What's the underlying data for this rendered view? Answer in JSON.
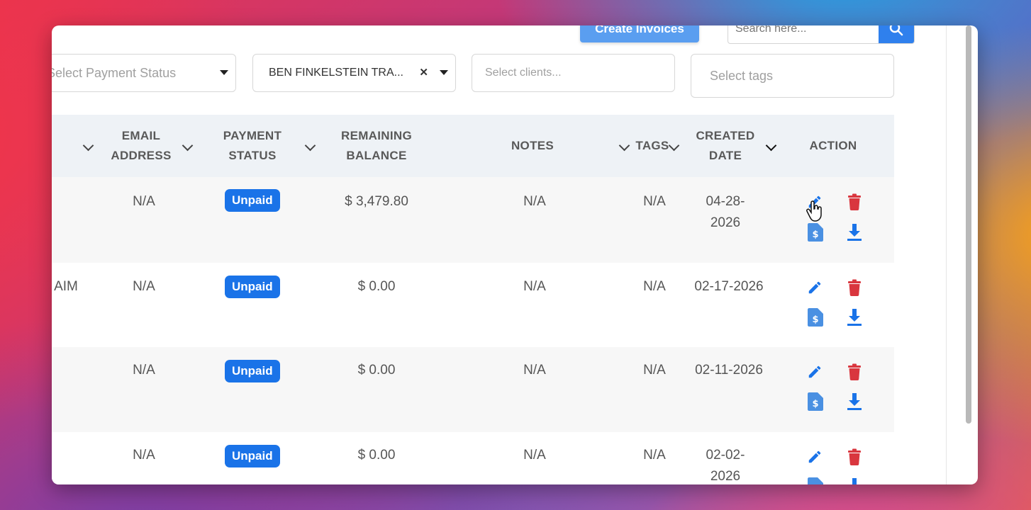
{
  "toolbar": {
    "create_label": "Create Invoices",
    "search_placeholder": "Search here..."
  },
  "filters": {
    "payment_status_placeholder": "Select Payment Status",
    "client_selected": "BEN FINKELSTEIN TRA...",
    "clients_placeholder": "Select clients...",
    "tags_placeholder": "Select tags"
  },
  "table": {
    "headers": {
      "email": [
        "EMAIL",
        "ADDRESS"
      ],
      "payment": [
        "PAYMENT",
        "STATUS"
      ],
      "balance": [
        "REMAINING",
        "BALANCE"
      ],
      "notes": "NOTES",
      "tags": "TAGS",
      "created": [
        "CREATED",
        "DATE"
      ],
      "action": "ACTION"
    },
    "rows": [
      {
        "partial": "",
        "email": "N/A",
        "status": "Unpaid",
        "balance": "$ 3,479.80",
        "notes": "N/A",
        "tags": "N/A",
        "date_line1": "04-28-",
        "date_line2": "2026"
      },
      {
        "partial": "AIM",
        "email": "N/A",
        "status": "Unpaid",
        "balance": "$ 0.00",
        "notes": "N/A",
        "tags": "N/A",
        "date_line1": "02-17-2026",
        "date_line2": ""
      },
      {
        "partial": "",
        "email": "N/A",
        "status": "Unpaid",
        "balance": "$ 0.00",
        "notes": "N/A",
        "tags": "N/A",
        "date_line1": "02-11-2026",
        "date_line2": ""
      },
      {
        "partial": "",
        "email": "N/A",
        "status": "Unpaid",
        "balance": "$ 0.00",
        "notes": "N/A",
        "tags": "N/A",
        "date_line1": "02-02-",
        "date_line2": "2026"
      }
    ]
  },
  "colors": {
    "primary": "#1a73e8",
    "delete": "#d9363e",
    "header_bg": "#eef2f6"
  }
}
